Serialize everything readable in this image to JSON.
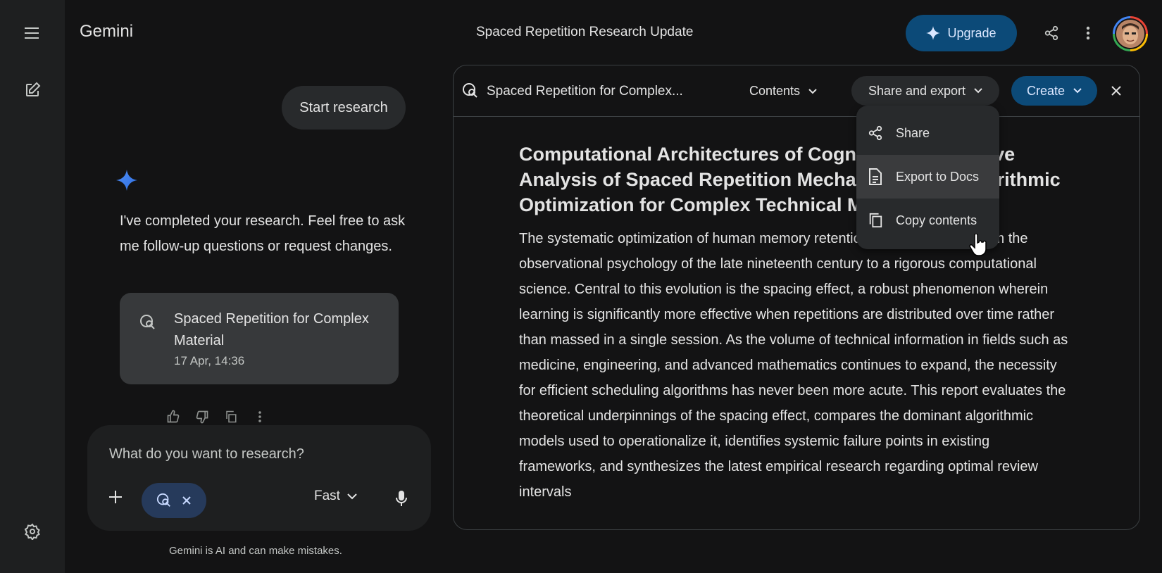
{
  "app": {
    "brand": "Gemini",
    "doc_title": "Spaced Repetition Research Update",
    "upgrade_label": "Upgrade"
  },
  "chat": {
    "user_message": "Start research",
    "ai_message": "I've completed your research. Feel free to ask me follow-up questions or request changes.",
    "report_card": {
      "title": "Spaced Repetition for Complex Material",
      "date": "17 Apr, 14:36"
    },
    "input_placeholder": "What do you want to research?",
    "model_label": "Fast",
    "disclaimer": "Gemini is AI and can make mistakes."
  },
  "doc_panel": {
    "title": "Spaced Repetition for Complex...",
    "contents_label": "Contents",
    "share_export_label": "Share and export",
    "create_label": "Create",
    "heading": "Computational Architectures of Cognitive Comparative Analysis of Spaced Repetition Mechanisms and Algorithmic Optimization for Complex Technical Mastery",
    "paragraph": "The systematic optimization of human memory retention has transitioned from the observational psychology of the late nineteenth century to a rigorous computational science. Central to this evolution is the spacing effect, a robust phenomenon wherein learning is significantly more effective when repetitions are distributed over time rather than massed in a single session. As the volume of technical information in fields such as medicine, engineering, and advanced mathematics continues to expand, the necessity for efficient scheduling algorithms has never been more acute. This report evaluates the theoretical underpinnings of the spacing effect, compares the dominant algorithmic models used to operationalize it, identifies systemic failure points in existing frameworks, and synthesizes the latest empirical research regarding optimal review intervals"
  },
  "share_menu": {
    "items": [
      {
        "label": "Share",
        "icon": "share-icon"
      },
      {
        "label": "Export to Docs",
        "icon": "document-icon"
      },
      {
        "label": "Copy contents",
        "icon": "copy-icon"
      }
    ]
  },
  "colors": {
    "background": "#131314",
    "rail": "#1e1f20",
    "accent_blue": "#0c4a78",
    "menu_bg": "#282a2c"
  }
}
